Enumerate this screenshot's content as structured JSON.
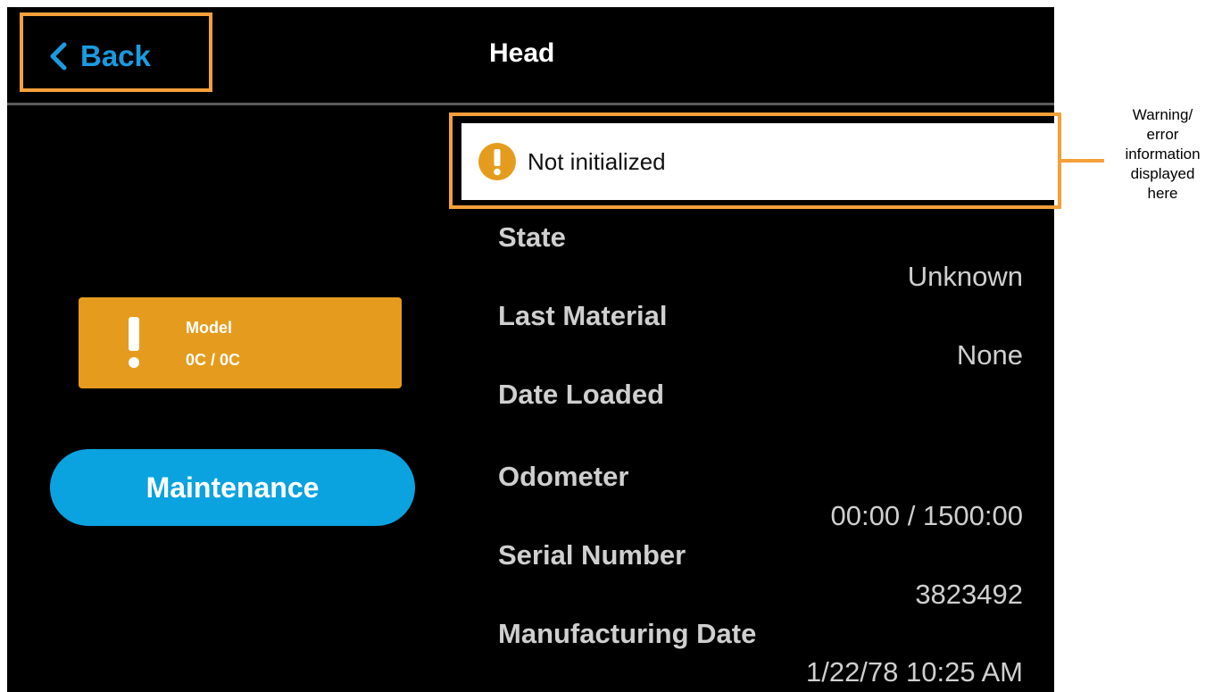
{
  "header": {
    "back_label": "Back",
    "title": "Head"
  },
  "status_card": {
    "title": "Model",
    "value": "0C / 0C",
    "color": "#e59c1e"
  },
  "maintenance_button": {
    "label": "Maintenance",
    "color": "#0aa3e0"
  },
  "warning": {
    "text": "Not initialized",
    "icon": "exclamation-circle-icon",
    "color": "#e59c1e"
  },
  "fields": [
    {
      "label": "State",
      "value": "Unknown"
    },
    {
      "label": "Last Material",
      "value": "None"
    },
    {
      "label": "Date Loaded",
      "value": ""
    },
    {
      "label": "Odometer",
      "value": "00:00 / 1500:00"
    },
    {
      "label": "Serial Number",
      "value": "3823492"
    },
    {
      "label": "Manufacturing Date",
      "value": "1/22/78 10:25 AM"
    }
  ],
  "annotation": {
    "text_lines": [
      "Warning/",
      "error",
      "information",
      "displayed",
      "here"
    ],
    "highlight_color": "#f5a03a"
  },
  "accent_color": "#1a9be0"
}
